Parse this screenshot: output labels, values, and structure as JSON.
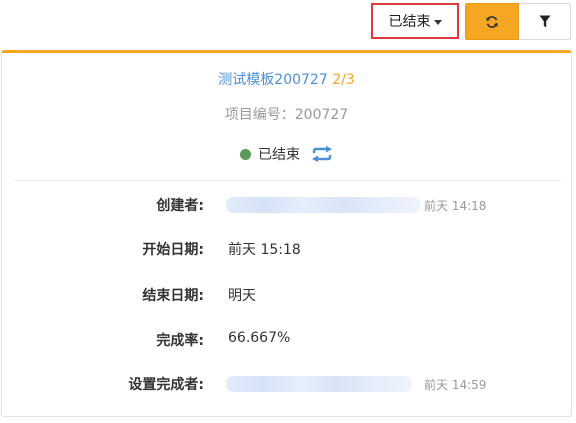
{
  "toolbar": {
    "status_filter_label": "已结束",
    "colors": {
      "refresh_bg": "#f5a623",
      "highlight_border": "#e03a3a"
    }
  },
  "card": {
    "title": "测试模板200727",
    "counter": "2/3",
    "project_no": "项目编号：200727",
    "status_text": "已结束",
    "status_color": "#5a9a5a",
    "accent_color": "#f5a623",
    "fields": {
      "creator_label": "创建者:",
      "creator_time": "前天 14:18",
      "start_date_label": "开始日期:",
      "start_date_value": "前天 15:18",
      "end_date_label": "结束日期:",
      "end_date_value": "明天",
      "completion_rate_label": "完成率:",
      "completion_rate_value": "66.667%",
      "completion_setter_label": "设置完成者:",
      "completion_setter_time": "前天 14:59"
    }
  },
  "icons": [
    "caret-down-icon",
    "refresh-icon",
    "filter-icon",
    "sync-icon"
  ]
}
